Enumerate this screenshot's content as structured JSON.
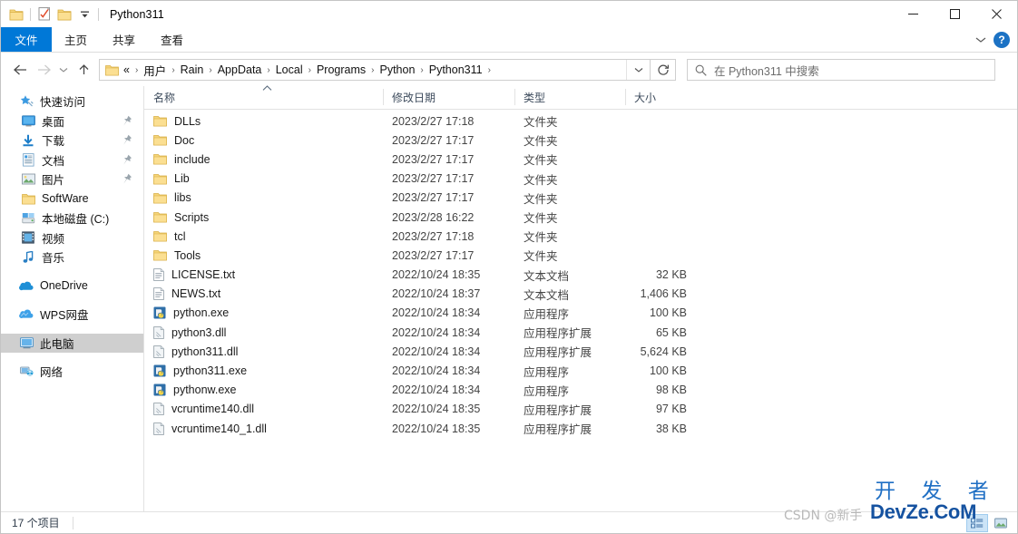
{
  "window": {
    "title": "Python311",
    "quick_access": [
      {
        "name": "folder-icon",
        "label": "属性"
      },
      {
        "name": "properties-icon",
        "label": "属性"
      },
      {
        "name": "new-folder-icon",
        "label": "新建文件夹"
      },
      {
        "name": "customize-qat-icon",
        "label": "自定义快速访问工具栏"
      }
    ],
    "controls": {
      "minimize": "─",
      "maximize": "□",
      "close": "✕"
    }
  },
  "ribbon": {
    "tabs": [
      {
        "label": "文件",
        "active": true
      },
      {
        "label": "主页",
        "active": false
      },
      {
        "label": "共享",
        "active": false
      },
      {
        "label": "查看",
        "active": false
      }
    ],
    "expand_label": "⌄",
    "help_label": "?"
  },
  "address": {
    "back_label": "←",
    "forward_label": "→",
    "history_label": "⌄",
    "up_label": "↑",
    "prefix": "«",
    "crumbs": [
      "用户",
      "Rain",
      "AppData",
      "Local",
      "Programs",
      "Python",
      "Python311"
    ],
    "dropdown_label": "⌄",
    "refresh_label": "↻"
  },
  "search": {
    "placeholder": "在 Python311 中搜索"
  },
  "sidebar": {
    "items": [
      {
        "label": "快速访问",
        "icon": "star-pin-icon",
        "pinned": false,
        "selected": false,
        "root": true
      },
      {
        "label": "桌面",
        "icon": "desktop-icon",
        "pinned": true,
        "selected": false
      },
      {
        "label": "下载",
        "icon": "download-icon",
        "pinned": true,
        "selected": false
      },
      {
        "label": "文档",
        "icon": "documents-icon",
        "pinned": true,
        "selected": false
      },
      {
        "label": "图片",
        "icon": "pictures-icon",
        "pinned": true,
        "selected": false
      },
      {
        "label": "SoftWare",
        "icon": "folder-icon",
        "pinned": false,
        "selected": false
      },
      {
        "label": "本地磁盘 (C:)",
        "icon": "drive-icon",
        "pinned": false,
        "selected": false
      },
      {
        "label": "视频",
        "icon": "videos-icon",
        "pinned": false,
        "selected": false
      },
      {
        "label": "音乐",
        "icon": "music-icon",
        "pinned": false,
        "selected": false
      },
      {
        "label": "OneDrive",
        "icon": "onedrive-icon",
        "pinned": false,
        "selected": false,
        "gap_before": true,
        "root": true
      },
      {
        "label": "WPS网盘",
        "icon": "wps-cloud-icon",
        "pinned": false,
        "selected": false,
        "gap_before": true,
        "root": true
      },
      {
        "label": "此电脑",
        "icon": "this-pc-icon",
        "pinned": false,
        "selected": true,
        "gap_before": true,
        "root": true
      },
      {
        "label": "网络",
        "icon": "network-icon",
        "pinned": false,
        "selected": false,
        "gap_before": true,
        "root": true
      }
    ]
  },
  "filelist": {
    "columns": [
      {
        "label": "名称",
        "key": "name",
        "sorted": "asc"
      },
      {
        "label": "修改日期",
        "key": "date"
      },
      {
        "label": "类型",
        "key": "type"
      },
      {
        "label": "大小",
        "key": "size"
      }
    ],
    "rows": [
      {
        "name": "DLLs",
        "date": "2023/2/27 17:18",
        "type": "文件夹",
        "size": "",
        "icon": "folder-icon"
      },
      {
        "name": "Doc",
        "date": "2023/2/27 17:17",
        "type": "文件夹",
        "size": "",
        "icon": "folder-icon"
      },
      {
        "name": "include",
        "date": "2023/2/27 17:17",
        "type": "文件夹",
        "size": "",
        "icon": "folder-icon"
      },
      {
        "name": "Lib",
        "date": "2023/2/27 17:17",
        "type": "文件夹",
        "size": "",
        "icon": "folder-icon"
      },
      {
        "name": "libs",
        "date": "2023/2/27 17:17",
        "type": "文件夹",
        "size": "",
        "icon": "folder-icon"
      },
      {
        "name": "Scripts",
        "date": "2023/2/28 16:22",
        "type": "文件夹",
        "size": "",
        "icon": "folder-icon"
      },
      {
        "name": "tcl",
        "date": "2023/2/27 17:18",
        "type": "文件夹",
        "size": "",
        "icon": "folder-icon"
      },
      {
        "name": "Tools",
        "date": "2023/2/27 17:17",
        "type": "文件夹",
        "size": "",
        "icon": "folder-icon"
      },
      {
        "name": "LICENSE.txt",
        "date": "2022/10/24 18:35",
        "type": "文本文档",
        "size": "32 KB",
        "icon": "text-file-icon"
      },
      {
        "name": "NEWS.txt",
        "date": "2022/10/24 18:37",
        "type": "文本文档",
        "size": "1,406 KB",
        "icon": "text-file-icon"
      },
      {
        "name": "python.exe",
        "date": "2022/10/24 18:34",
        "type": "应用程序",
        "size": "100 KB",
        "icon": "python-exe-icon"
      },
      {
        "name": "python3.dll",
        "date": "2022/10/24 18:34",
        "type": "应用程序扩展",
        "size": "65 KB",
        "icon": "dll-icon"
      },
      {
        "name": "python311.dll",
        "date": "2022/10/24 18:34",
        "type": "应用程序扩展",
        "size": "5,624 KB",
        "icon": "dll-icon"
      },
      {
        "name": "python311.exe",
        "date": "2022/10/24 18:34",
        "type": "应用程序",
        "size": "100 KB",
        "icon": "python-exe-icon"
      },
      {
        "name": "pythonw.exe",
        "date": "2022/10/24 18:34",
        "type": "应用程序",
        "size": "98 KB",
        "icon": "python-exe-icon"
      },
      {
        "name": "vcruntime140.dll",
        "date": "2022/10/24 18:35",
        "type": "应用程序扩展",
        "size": "97 KB",
        "icon": "dll-icon"
      },
      {
        "name": "vcruntime140_1.dll",
        "date": "2022/10/24 18:35",
        "type": "应用程序扩展",
        "size": "38 KB",
        "icon": "dll-icon"
      }
    ]
  },
  "status": {
    "item_count": "17 个项目",
    "view_details_label": "详细信息",
    "view_large_label": "大图标"
  },
  "watermarks": {
    "csdn": "CSDN @新手",
    "dev_cn": "开 发 者",
    "dev_site": "DevZe.CoM"
  },
  "colors": {
    "accent": "#0078d7",
    "folder": "#ffd66e",
    "selected_row": "#cfcfcf",
    "help_blue": "#1c72c4",
    "watermark_blue": "#1552a0"
  }
}
